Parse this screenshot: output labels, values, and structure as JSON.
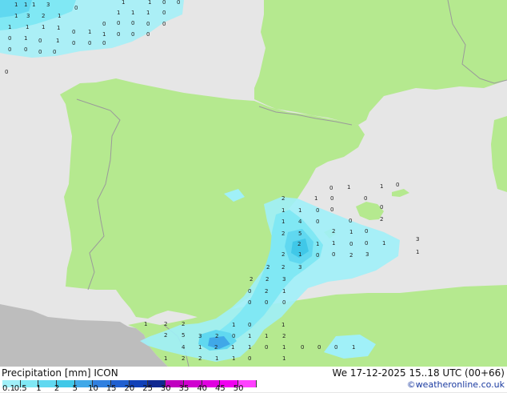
{
  "footer": {
    "title": "Precipitation [mm]  ICON",
    "time": "We 17-12-2025  15..18 UTC (00+66)",
    "credit": "©weatheronline.co.uk"
  },
  "legend": {
    "ticks": [
      "0.1",
      "0.5",
      "1",
      "2",
      "5",
      "10",
      "15",
      "20",
      "25",
      "30",
      "35",
      "40",
      "45",
      "50"
    ],
    "colors": [
      "#a0f0f8",
      "#80e8f4",
      "#60d8f0",
      "#40c8e8",
      "#40a8e8",
      "#3080e0",
      "#2060d0",
      "#1040b8",
      "#102890",
      "#c000c0",
      "#d000d0",
      "#e000e0",
      "#f000f0",
      "#ff40ff"
    ]
  },
  "map": {
    "colors": {
      "sea": "#e6e6e6",
      "land": "#b5e98f",
      "outside": "#bdbdbd",
      "border": "#9a9a9a"
    },
    "labels": [
      {
        "t": "1"
      },
      {
        "t": "1"
      },
      {
        "t": "3"
      },
      {
        "t": "0"
      },
      {
        "t": "1"
      },
      {
        "t": "1"
      },
      {
        "t": "0"
      },
      {
        "t": "0"
      },
      {
        "t": "1"
      },
      {
        "t": "3"
      },
      {
        "t": "2"
      },
      {
        "t": "1"
      },
      {
        "t": "1"
      },
      {
        "t": "1"
      },
      {
        "t": "1"
      },
      {
        "t": "0"
      },
      {
        "t": "1"
      },
      {
        "t": "1"
      },
      {
        "t": "1"
      },
      {
        "t": "1"
      },
      {
        "t": "0"
      },
      {
        "t": "0"
      },
      {
        "t": "0"
      },
      {
        "t": "0"
      },
      {
        "t": "0"
      },
      {
        "t": "0"
      },
      {
        "t": "1"
      },
      {
        "t": "1"
      },
      {
        "t": "0"
      },
      {
        "t": "0"
      },
      {
        "t": "0"
      },
      {
        "t": "0"
      },
      {
        "t": "0"
      },
      {
        "t": "1"
      },
      {
        "t": "0"
      },
      {
        "t": "0"
      },
      {
        "t": "0"
      },
      {
        "t": "0"
      },
      {
        "t": "0"
      },
      {
        "t": "0"
      },
      {
        "t": "0"
      },
      {
        "t": "1"
      },
      {
        "t": "0"
      },
      {
        "t": "1"
      },
      {
        "t": "0"
      },
      {
        "t": "1"
      },
      {
        "t": "1"
      },
      {
        "t": "0"
      },
      {
        "t": "2"
      },
      {
        "t": "1"
      },
      {
        "t": "0"
      },
      {
        "t": "0"
      },
      {
        "t": "1"
      },
      {
        "t": "1"
      },
      {
        "t": "0"
      },
      {
        "t": "0"
      },
      {
        "t": "0"
      },
      {
        "t": "0"
      },
      {
        "t": "1"
      },
      {
        "t": "0"
      },
      {
        "t": "4"
      },
      {
        "t": "2"
      },
      {
        "t": "2"
      },
      {
        "t": "2"
      },
      {
        "t": "1"
      },
      {
        "t": "0"
      },
      {
        "t": "5"
      },
      {
        "t": "3"
      },
      {
        "t": "2"
      },
      {
        "t": "1"
      },
      {
        "t": "1"
      },
      {
        "t": "0"
      },
      {
        "t": "0"
      },
      {
        "t": "1"
      },
      {
        "t": "1"
      },
      {
        "t": "2"
      },
      {
        "t": "1"
      },
      {
        "t": "0"
      },
      {
        "t": "0"
      },
      {
        "t": "2"
      },
      {
        "t": "3"
      },
      {
        "t": "2"
      },
      {
        "t": "2"
      },
      {
        "t": "3"
      },
      {
        "t": "2"
      },
      {
        "t": "2"
      },
      {
        "t": "3"
      },
      {
        "t": "0"
      },
      {
        "t": "2"
      },
      {
        "t": "1"
      },
      {
        "t": "0"
      },
      {
        "t": "0"
      },
      {
        "t": "0"
      },
      {
        "t": "1"
      },
      {
        "t": "2"
      },
      {
        "t": "2"
      },
      {
        "t": "1"
      },
      {
        "t": "0"
      },
      {
        "t": "1"
      },
      {
        "t": "2"
      },
      {
        "t": "5"
      },
      {
        "t": "3"
      },
      {
        "t": "2"
      },
      {
        "t": "0"
      },
      {
        "t": "1"
      },
      {
        "t": "1"
      },
      {
        "t": "2"
      },
      {
        "t": "4"
      },
      {
        "t": "1"
      },
      {
        "t": "2"
      },
      {
        "t": "1"
      },
      {
        "t": "1"
      },
      {
        "t": "0"
      },
      {
        "t": "1"
      },
      {
        "t": "0"
      },
      {
        "t": "0"
      },
      {
        "t": "0"
      },
      {
        "t": "1"
      },
      {
        "t": "1"
      },
      {
        "t": "2"
      },
      {
        "t": "2"
      },
      {
        "t": "1"
      },
      {
        "t": "1"
      },
      {
        "t": "0"
      },
      {
        "t": "1"
      }
    ]
  }
}
